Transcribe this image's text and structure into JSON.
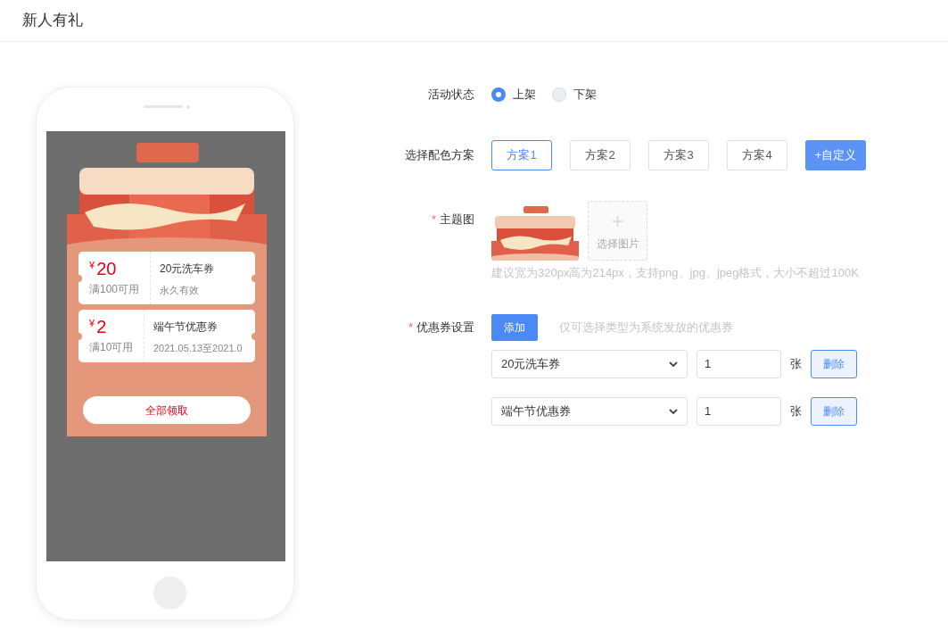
{
  "page_title": "新人有礼",
  "preview": {
    "coupons": [
      {
        "symbol": "¥",
        "amount": "20",
        "condition": "满100可用",
        "name": "20元洗车券",
        "validity": "永久有效"
      },
      {
        "symbol": "¥",
        "amount": "2",
        "condition": "满10可用",
        "name": "端午节优惠券",
        "validity": "2021.05.13至2021.0"
      }
    ],
    "claim_button": "全部领取"
  },
  "form": {
    "status": {
      "label": "活动状态",
      "options": [
        {
          "label": "上架",
          "selected": true
        },
        {
          "label": "下架",
          "selected": false
        }
      ]
    },
    "scheme": {
      "label": "选择配色方案",
      "options": [
        {
          "label": "方案1",
          "selected": true
        },
        {
          "label": "方案2",
          "selected": false
        },
        {
          "label": "方案3",
          "selected": false
        },
        {
          "label": "方案4",
          "selected": false
        }
      ],
      "custom_button": "+自定义"
    },
    "theme_image": {
      "required_mark": "*",
      "label": "主题图",
      "upload_plus": "+",
      "upload_label": "选择图片",
      "hint": "建议宽为320px高为214px，支持png、jpg、jpeg格式，大小不超过100K"
    },
    "coupon_settings": {
      "required_mark": "*",
      "label": "优惠券设置",
      "add_button": "添加",
      "hint": "仅可选择类型为系统发放的优惠券",
      "rows": [
        {
          "coupon": "20元洗车券",
          "quantity": "1",
          "unit": "张",
          "delete_button": "删除"
        },
        {
          "coupon": "端午节优惠券",
          "quantity": "1",
          "unit": "张",
          "delete_button": "删除"
        }
      ]
    }
  }
}
